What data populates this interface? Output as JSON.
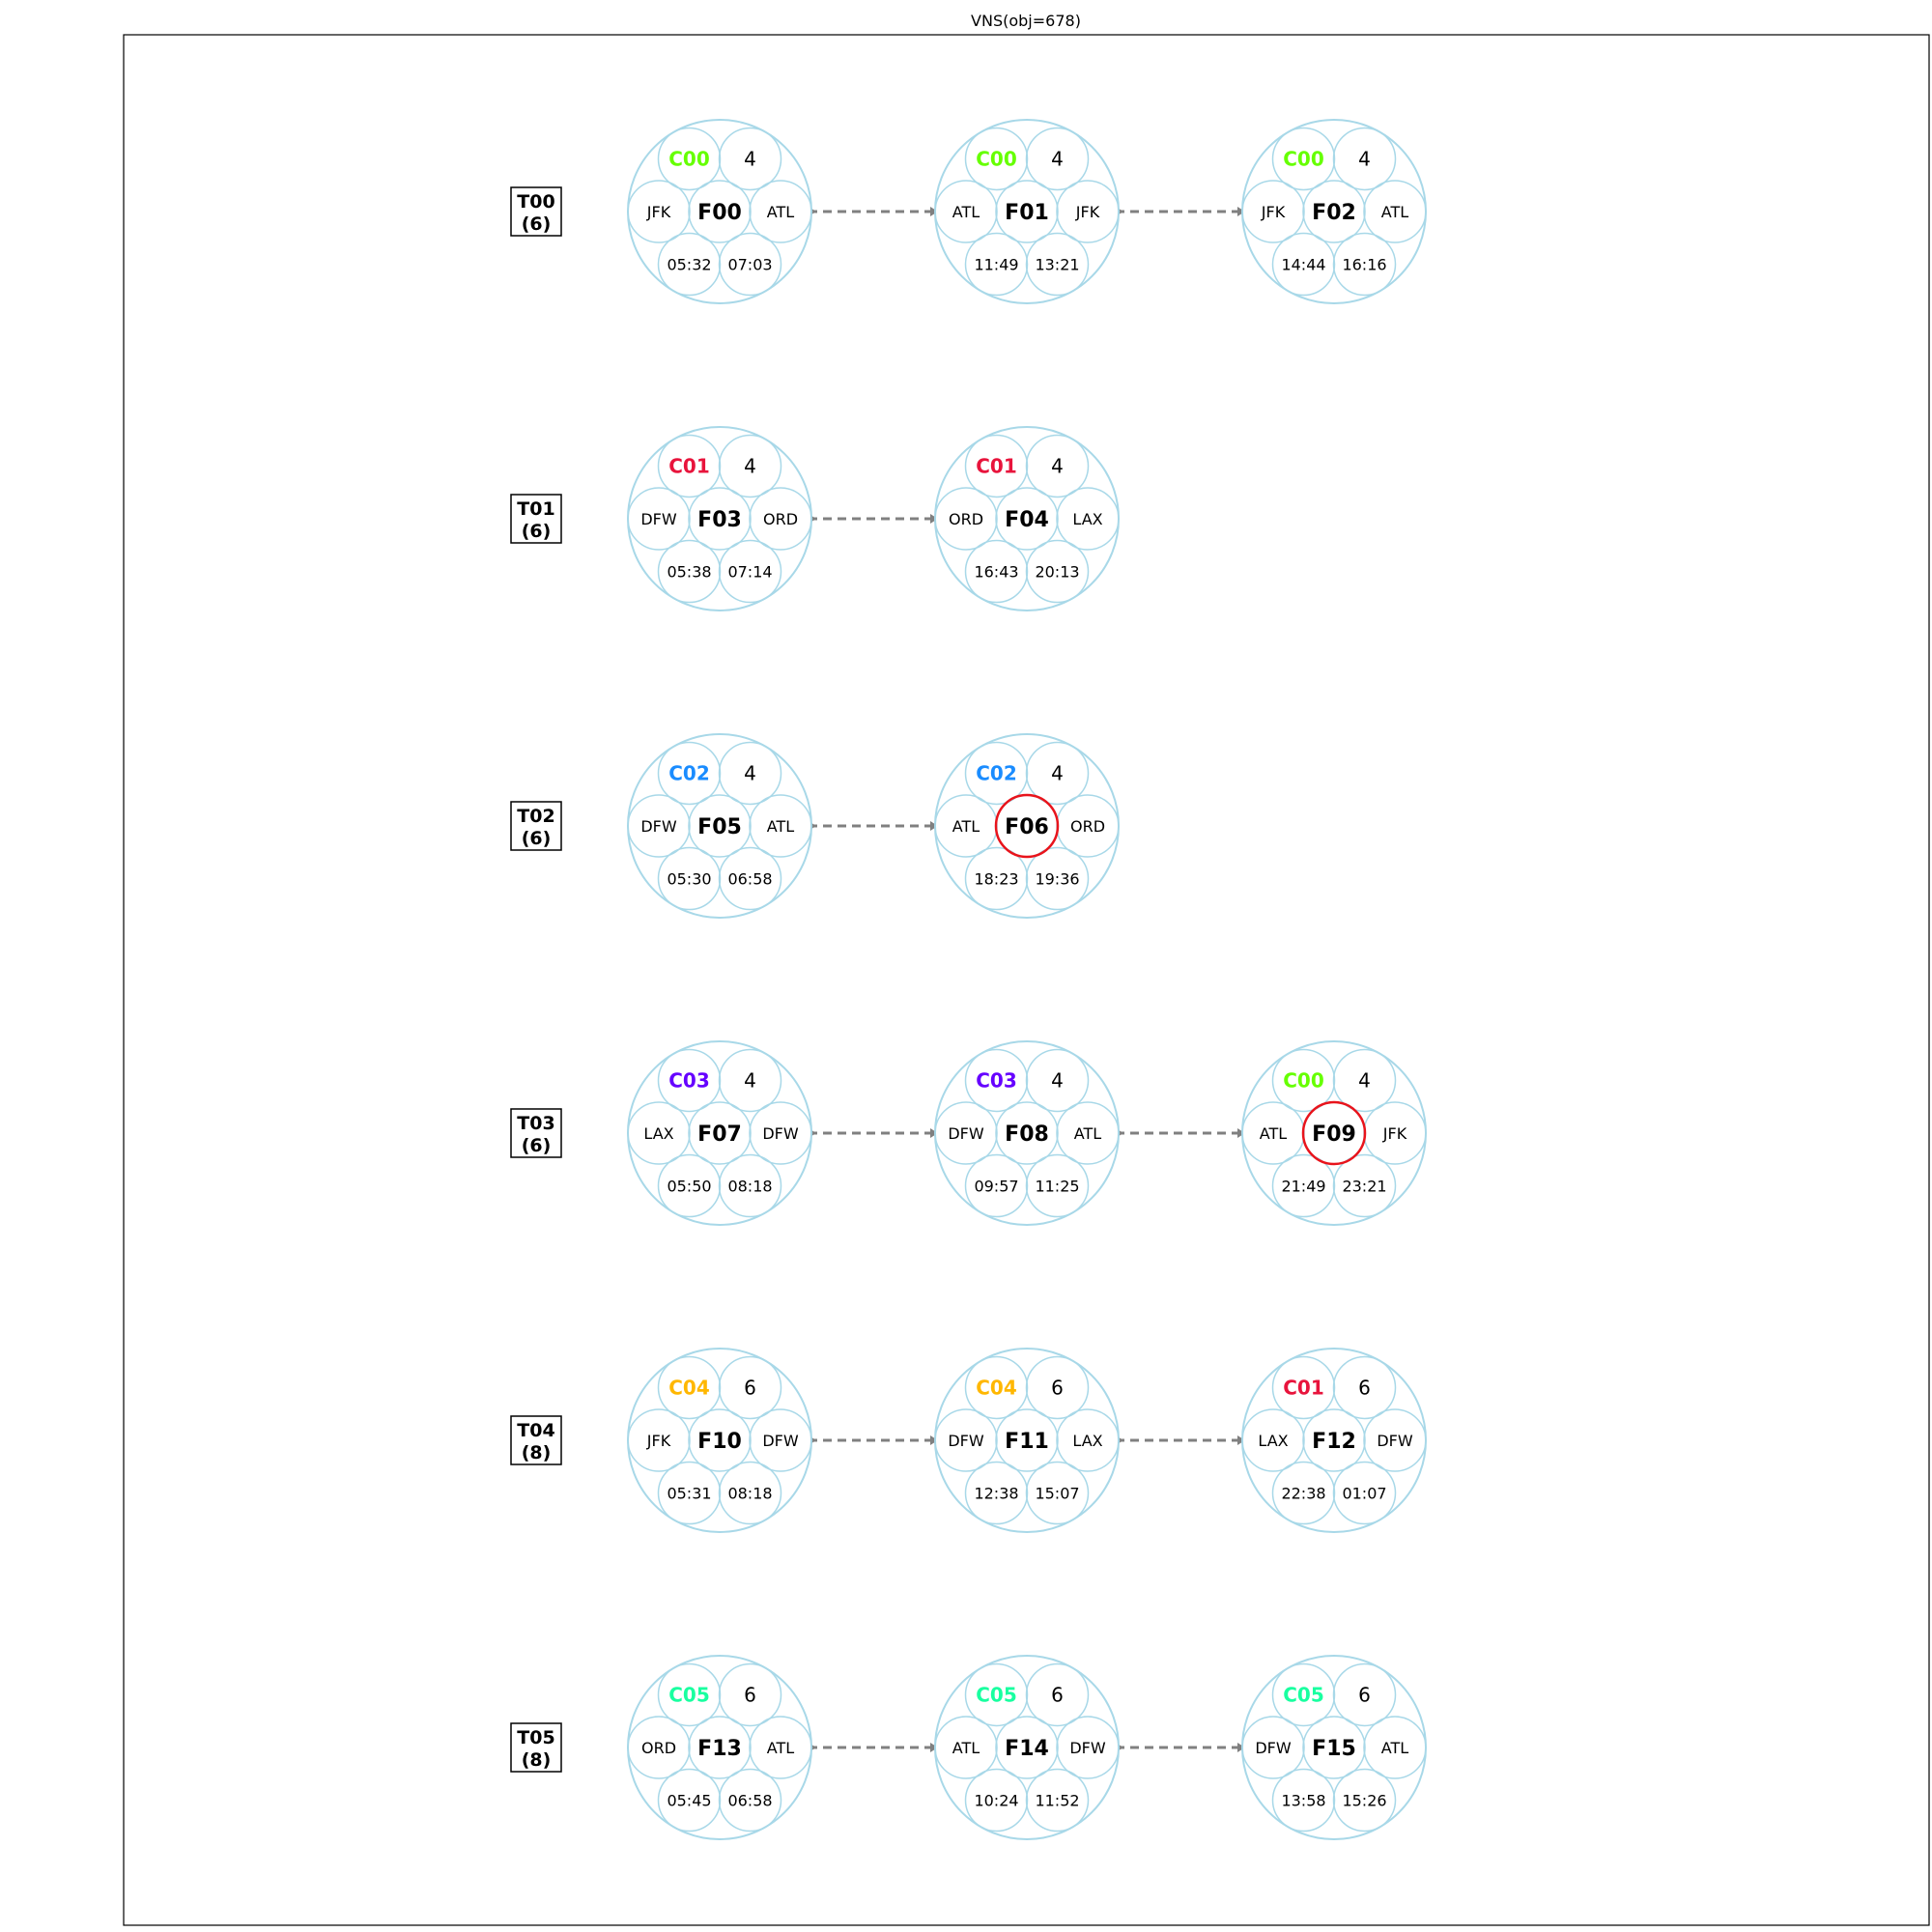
{
  "title": "VNS(obj=678)",
  "colors": {
    "ring": "#a8d8e8",
    "highlight": "#e8141c",
    "arrow": "#808080",
    "crew": {
      "C00": "#66ff00",
      "C01": "#e8143c",
      "C02": "#1a8cff",
      "C03": "#6600ff",
      "C04": "#ffb700",
      "C05": "#19ffa0"
    }
  },
  "rows": [
    {
      "label": "T00",
      "count": "(6)",
      "flights": [
        {
          "id": "F00",
          "crew": "C00",
          "qty": "4",
          "origin": "JFK",
          "dest": "ATL",
          "dep": "05:32",
          "arr": "07:03",
          "highlight": false
        },
        {
          "id": "F01",
          "crew": "C00",
          "qty": "4",
          "origin": "ATL",
          "dest": "JFK",
          "dep": "11:49",
          "arr": "13:21",
          "highlight": false
        },
        {
          "id": "F02",
          "crew": "C00",
          "qty": "4",
          "origin": "JFK",
          "dest": "ATL",
          "dep": "14:44",
          "arr": "16:16",
          "highlight": false
        }
      ]
    },
    {
      "label": "T01",
      "count": "(6)",
      "flights": [
        {
          "id": "F03",
          "crew": "C01",
          "qty": "4",
          "origin": "DFW",
          "dest": "ORD",
          "dep": "05:38",
          "arr": "07:14",
          "highlight": false
        },
        {
          "id": "F04",
          "crew": "C01",
          "qty": "4",
          "origin": "ORD",
          "dest": "LAX",
          "dep": "16:43",
          "arr": "20:13",
          "highlight": false
        }
      ]
    },
    {
      "label": "T02",
      "count": "(6)",
      "flights": [
        {
          "id": "F05",
          "crew": "C02",
          "qty": "4",
          "origin": "DFW",
          "dest": "ATL",
          "dep": "05:30",
          "arr": "06:58",
          "highlight": false
        },
        {
          "id": "F06",
          "crew": "C02",
          "qty": "4",
          "origin": "ATL",
          "dest": "ORD",
          "dep": "18:23",
          "arr": "19:36",
          "highlight": true
        }
      ]
    },
    {
      "label": "T03",
      "count": "(6)",
      "flights": [
        {
          "id": "F07",
          "crew": "C03",
          "qty": "4",
          "origin": "LAX",
          "dest": "DFW",
          "dep": "05:50",
          "arr": "08:18",
          "highlight": false
        },
        {
          "id": "F08",
          "crew": "C03",
          "qty": "4",
          "origin": "DFW",
          "dest": "ATL",
          "dep": "09:57",
          "arr": "11:25",
          "highlight": false
        },
        {
          "id": "F09",
          "crew": "C00",
          "qty": "4",
          "origin": "ATL",
          "dest": "JFK",
          "dep": "21:49",
          "arr": "23:21",
          "highlight": true
        }
      ]
    },
    {
      "label": "T04",
      "count": "(8)",
      "flights": [
        {
          "id": "F10",
          "crew": "C04",
          "qty": "6",
          "origin": "JFK",
          "dest": "DFW",
          "dep": "05:31",
          "arr": "08:18",
          "highlight": false
        },
        {
          "id": "F11",
          "crew": "C04",
          "qty": "6",
          "origin": "DFW",
          "dest": "LAX",
          "dep": "12:38",
          "arr": "15:07",
          "highlight": false
        },
        {
          "id": "F12",
          "crew": "C01",
          "qty": "6",
          "origin": "LAX",
          "dest": "DFW",
          "dep": "22:38",
          "arr": "01:07",
          "highlight": false
        }
      ]
    },
    {
      "label": "T05",
      "count": "(8)",
      "flights": [
        {
          "id": "F13",
          "crew": "C05",
          "qty": "6",
          "origin": "ORD",
          "dest": "ATL",
          "dep": "05:45",
          "arr": "06:58",
          "highlight": false
        },
        {
          "id": "F14",
          "crew": "C05",
          "qty": "6",
          "origin": "ATL",
          "dest": "DFW",
          "dep": "10:24",
          "arr": "11:52",
          "highlight": false
        },
        {
          "id": "F15",
          "crew": "C05",
          "qty": "6",
          "origin": "DFW",
          "dest": "ATL",
          "dep": "13:58",
          "arr": "15:26",
          "highlight": false
        }
      ]
    }
  ]
}
